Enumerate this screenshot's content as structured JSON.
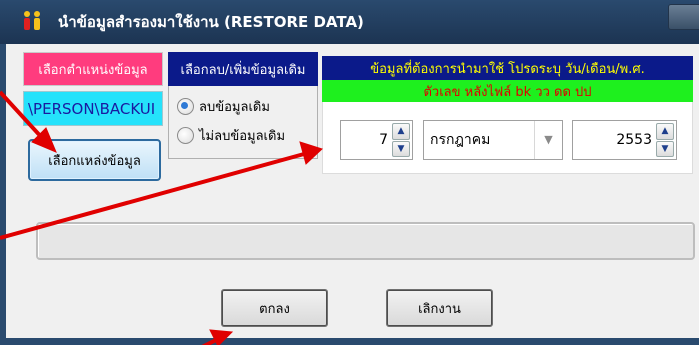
{
  "window": {
    "title": "นำข้อมูลสำรองมาใช้งาน (RESTORE DATA)",
    "accent": "#2a4a6e"
  },
  "source": {
    "header": "เลือกตำแหน่งข้อมูล",
    "path": "\\PERSON\\BACKUI",
    "button_label": "เลือกแหล่งข้อมูล",
    "header_color": "#ff3c7e",
    "path_bg": "#25e2fb"
  },
  "options": {
    "header": "เลือกลบ/เพิ่มข้อมูลเดิม",
    "delete_label": "ลบข้อมูลเดิม",
    "keep_label": "ไม่ลบข้อมูลเดิม",
    "selected": "delete"
  },
  "date": {
    "header": "ข้อมูลที่ต้องการนำมาใช้  โปรดระบุ วัน/เดือน/พ.ศ.",
    "note": "ตัวเลข หลังไฟล์ bk วว ดด ปป",
    "day": "7",
    "month": "กรกฎาคม",
    "year": "2553",
    "header_bg": "#0b1a8a",
    "note_bg": "#1ef01e"
  },
  "progress": {
    "fraction": 0
  },
  "buttons": {
    "ok": "ตกลง",
    "cancel": "เลิกงาน"
  },
  "icons": {
    "app": "people-icon",
    "spin_up": "▲",
    "spin_down": "▼",
    "dropdown": "▼"
  },
  "annotations": {
    "arrow_color": "#e00000"
  }
}
